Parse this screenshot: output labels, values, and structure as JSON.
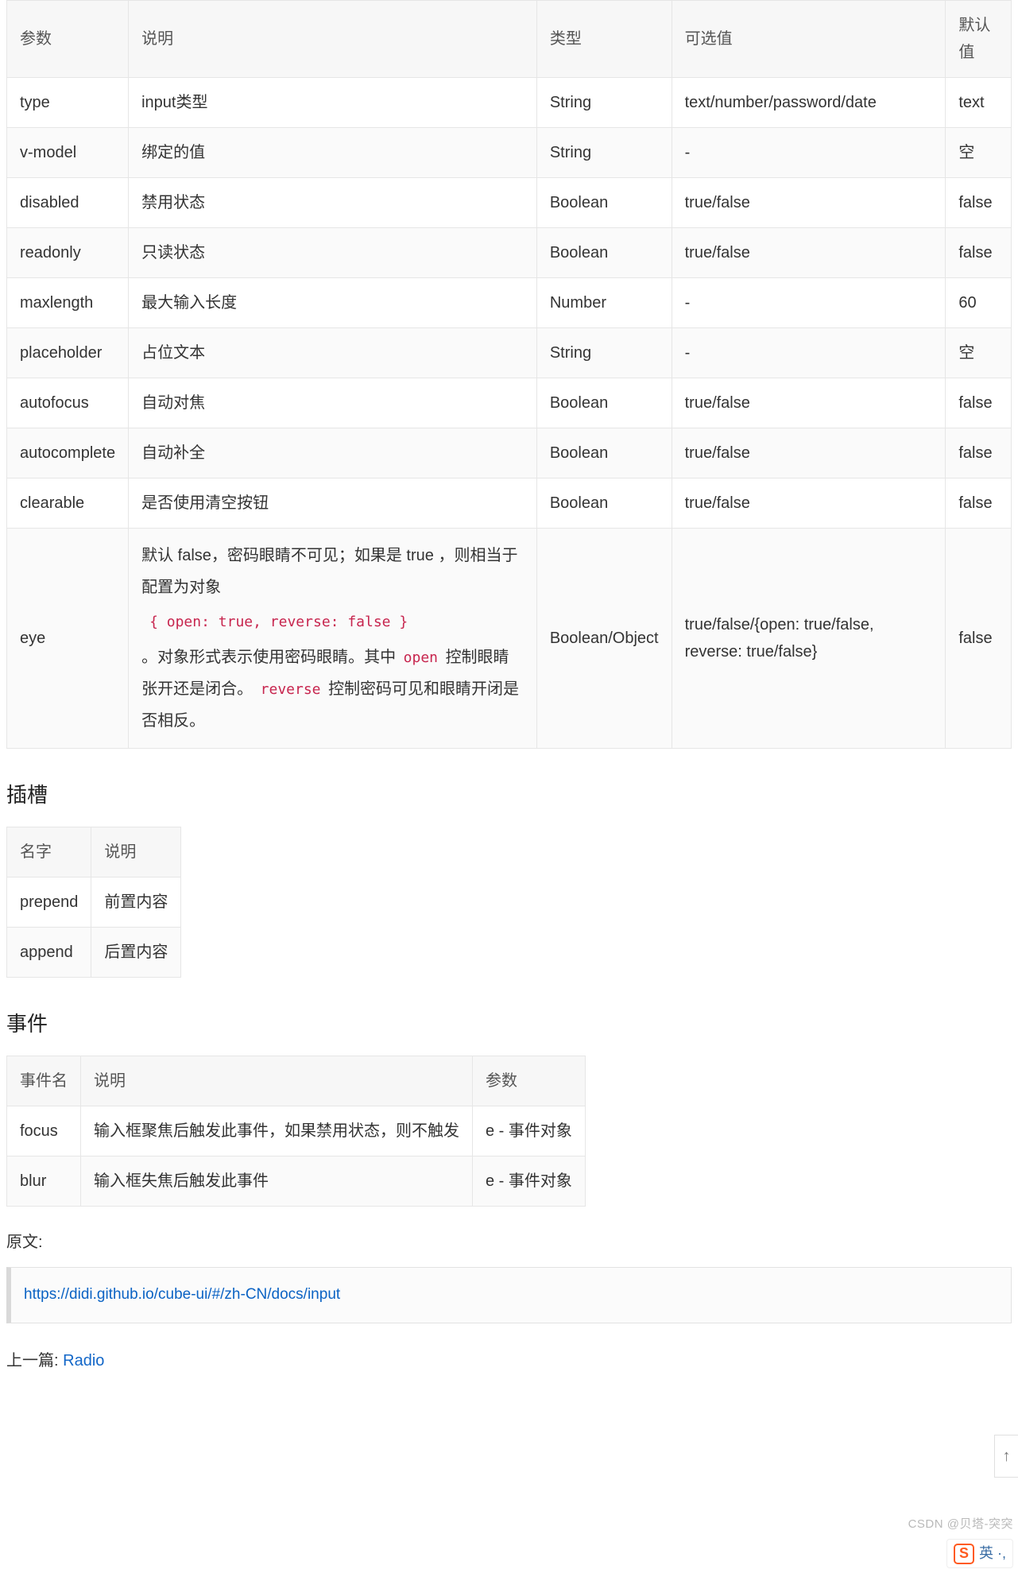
{
  "props_table": {
    "headers": [
      "参数",
      "说明",
      "类型",
      "可选值",
      "默认值"
    ],
    "rows": [
      {
        "param": "type",
        "desc": "input类型",
        "type": "String",
        "options": "text/number/password/date",
        "default": "text"
      },
      {
        "param": "v-model",
        "desc": "绑定的值",
        "type": "String",
        "options": "-",
        "default": "空"
      },
      {
        "param": "disabled",
        "desc": "禁用状态",
        "type": "Boolean",
        "options": "true/false",
        "default": "false"
      },
      {
        "param": "readonly",
        "desc": "只读状态",
        "type": "Boolean",
        "options": "true/false",
        "default": "false"
      },
      {
        "param": "maxlength",
        "desc": "最大输入长度",
        "type": "Number",
        "options": "-",
        "default": "60"
      },
      {
        "param": "placeholder",
        "desc": "占位文本",
        "type": "String",
        "options": "-",
        "default": "空"
      },
      {
        "param": "autofocus",
        "desc": "自动对焦",
        "type": "Boolean",
        "options": "true/false",
        "default": "false"
      },
      {
        "param": "autocomplete",
        "desc": "自动补全",
        "type": "Boolean",
        "options": "true/false",
        "default": "false"
      },
      {
        "param": "clearable",
        "desc": "是否使用清空按钮",
        "type": "Boolean",
        "options": "true/false",
        "default": "false"
      }
    ],
    "eye_row": {
      "param": "eye",
      "desc_pre": "默认 false，密码眼睛不可见；如果是 true ，则相当于配置为对象",
      "code_block": "{ open: true, reverse: false }",
      "desc_mid1": "。对象形式表示使用密码眼睛。其中 ",
      "code_open": "open",
      "desc_mid2": " 控制眼睛张开还是闭合。 ",
      "code_reverse": "reverse",
      "desc_mid3": " 控制密码可见和眼睛开闭是否相反。",
      "type": "Boolean/Object",
      "options": "true/false/{open: true/false, reverse: true/false}",
      "default": "false"
    }
  },
  "slots_heading": "插槽",
  "slots_table": {
    "headers": [
      "名字",
      "说明"
    ],
    "rows": [
      {
        "name": "prepend",
        "desc": "前置内容"
      },
      {
        "name": "append",
        "desc": "后置内容"
      }
    ]
  },
  "events_heading": "事件",
  "events_table": {
    "headers": [
      "事件名",
      "说明",
      "参数"
    ],
    "rows": [
      {
        "name": "focus",
        "desc": "输入框聚焦后触发此事件，如果禁用状态，则不触发",
        "arg": "e - 事件对象"
      },
      {
        "name": "blur",
        "desc": "输入框失焦后触发此事件",
        "arg": "e - 事件对象"
      }
    ]
  },
  "source_label": "原文:",
  "source_url": "https://didi.github.io/cube-ui/#/zh-CN/docs/input",
  "next_prefix": "上一篇: ",
  "next_link": "Radio",
  "watermark": "CSDN @贝塔-突突",
  "ime_logo_letter": "S",
  "ime_text": "英 ·,",
  "scroll_top_glyph": "↑"
}
